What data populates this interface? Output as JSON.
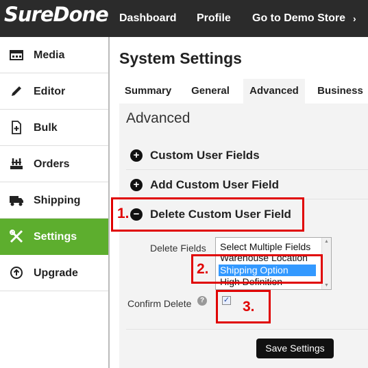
{
  "brand": {
    "logo": "SureDone"
  },
  "topnav": {
    "items": [
      "Dashboard",
      "Profile",
      "Go to Demo Store"
    ],
    "more": "›"
  },
  "sidebar": {
    "items": [
      {
        "label": "Media",
        "icon": "media-icon"
      },
      {
        "label": "Editor",
        "icon": "pencil-icon"
      },
      {
        "label": "Bulk",
        "icon": "bulk-file-icon"
      },
      {
        "label": "Orders",
        "icon": "orders-icon"
      },
      {
        "label": "Shipping",
        "icon": "truck-icon"
      },
      {
        "label": "Settings",
        "icon": "tools-icon",
        "active": true
      },
      {
        "label": "Upgrade",
        "icon": "upgrade-icon"
      }
    ]
  },
  "main": {
    "title": "System Settings",
    "tabs": [
      "Summary",
      "General",
      "Advanced",
      "Business"
    ],
    "active_tab": "Advanced",
    "section_title": "Advanced",
    "accordions": [
      {
        "label": "Custom User Fields",
        "icon": "plus-circle-icon"
      },
      {
        "label": "Add Custom User Field",
        "icon": "plus-circle-icon"
      },
      {
        "label": "Delete Custom User Field",
        "icon": "minus-circle-icon"
      }
    ],
    "delete_fields": {
      "label": "Delete Fields",
      "options": [
        "Select Multiple Fields",
        "Warehouse Location",
        "Shipping Option",
        "High Definition"
      ],
      "selected": "Shipping Option"
    },
    "confirm_delete": {
      "label": "Confirm Delete",
      "help": "?",
      "checked": true,
      "check_glyph": "✓"
    },
    "save_button": "Save Settings"
  },
  "annotations": [
    "1.",
    "2.",
    "3."
  ],
  "colors": {
    "topbar": "#2b2b2b",
    "active_sidebar": "#5dae2e",
    "annotation": "#e00000",
    "selection": "#3399ff"
  }
}
